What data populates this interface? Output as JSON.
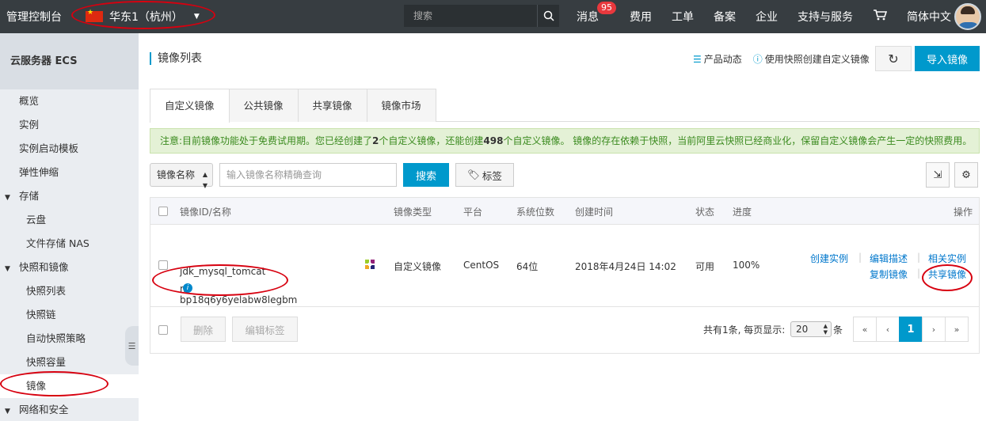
{
  "topbar": {
    "brand": "管理控制台",
    "region": "华东1（杭州）",
    "search_placeholder": "搜索",
    "nav": [
      "消息",
      "费用",
      "工单",
      "备案",
      "企业",
      "支持与服务",
      "简体中文"
    ],
    "message_badge": "95"
  },
  "sidebar": {
    "title": "云服务器 ECS",
    "items": [
      {
        "label": "概览"
      },
      {
        "label": "实例"
      },
      {
        "label": "实例启动模板"
      },
      {
        "label": "弹性伸缩"
      },
      {
        "label": "存储"
      },
      {
        "label": "云盘"
      },
      {
        "label": "文件存储 NAS"
      },
      {
        "label": "快照和镜像"
      },
      {
        "label": "快照列表"
      },
      {
        "label": "快照链"
      },
      {
        "label": "自动快照策略"
      },
      {
        "label": "快照容量"
      },
      {
        "label": "镜像"
      },
      {
        "label": "网络和安全"
      }
    ]
  },
  "main": {
    "title": "镜像列表",
    "product_news": "产品动态",
    "snapshot_help": "使用快照创建自定义镜像",
    "import_button": "导入镜像",
    "tabs": [
      "自定义镜像",
      "公共镜像",
      "共享镜像",
      "镜像市场"
    ],
    "notice": {
      "p1": "注意:目前镜像功能处于免费试用期。您已经创建了",
      "n1": "2",
      "p2": "个自定义镜像，还能创建",
      "n2": "498",
      "p3": "个自定义镜像。 镜像的存在依赖于快照，当前阿里云快照已经商业化，保留自定义镜像会产生一定的快照费用。"
    },
    "filter": {
      "select_value": "镜像名称",
      "input_placeholder": "输入镜像名称精确查询",
      "search_button": "搜索",
      "tag_button": "标签"
    },
    "table": {
      "headers": [
        "镜像ID/名称",
        "镜像类型",
        "平台",
        "系统位数",
        "创建时间",
        "状态",
        "进度",
        "操作"
      ],
      "row": {
        "id": "m-bp18q6y6yelabw8legbm",
        "name": "jdk_mysql_tomcat",
        "type": "自定义镜像",
        "platform": "CentOS",
        "bits": "64位",
        "created": "2018年4月24日 14:02",
        "status": "可用",
        "progress": "100%",
        "actions": [
          "创建实例",
          "编辑描述",
          "相关实例",
          "复制镜像",
          "共享镜像"
        ]
      }
    },
    "footer": {
      "delete": "删除",
      "edit_tags": "编辑标签",
      "total_text": "共有1条, 每页显示:",
      "page_size": "20",
      "unit": "条",
      "pages": [
        "«",
        "‹",
        "1",
        "›",
        "»"
      ]
    }
  }
}
